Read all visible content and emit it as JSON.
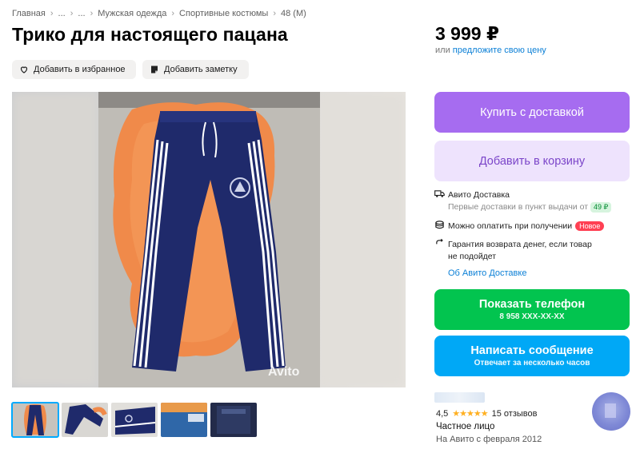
{
  "breadcrumb": [
    "Главная",
    "...",
    "...",
    "Мужская одежда",
    "Спортивные костюмы",
    "48 (M)"
  ],
  "title": "Трико для настоящего пацана",
  "actions": {
    "favorite_label": "Добавить в избранное",
    "note_label": "Добавить заметку"
  },
  "price": "3 999 ₽",
  "offer": {
    "prefix": "или ",
    "link": "предложите свою цену"
  },
  "buttons": {
    "buy": "Купить с доставкой",
    "cart": "Добавить в корзину",
    "phone_title": "Показать телефон",
    "phone_number": "8 958 XXX-XX-XX",
    "message_title": "Написать сообщение",
    "message_sub": "Отвечает за несколько часов"
  },
  "delivery": {
    "title": "Авито Доставка",
    "first_text": "Первые доставки в пункт выдачи от",
    "first_price": "49 ₽",
    "pay_text": "Можно оплатить при получении",
    "new_badge": "Новое",
    "guarantee_line1": "Гарантия возврата денег, если товар",
    "guarantee_line2": "не подойдет",
    "about_link": "Об Авито Доставке"
  },
  "seller": {
    "rating": "4,5",
    "stars": 4.5,
    "reviews": "15 отзывов",
    "type": "Частное лицо",
    "since": "На Авито с февраля 2012"
  },
  "photo": {
    "watermark": "Avito"
  },
  "colors": {
    "purple": "#a66cf0",
    "purple_light": "#eee3fd",
    "green": "#02c44f",
    "blue": "#00a8f6",
    "link": "#0a7fd6",
    "pants": "#1f2a6b"
  },
  "icons": [
    "heart-icon",
    "note-icon",
    "truck-icon",
    "coins-icon",
    "return-icon",
    "star-icon"
  ]
}
